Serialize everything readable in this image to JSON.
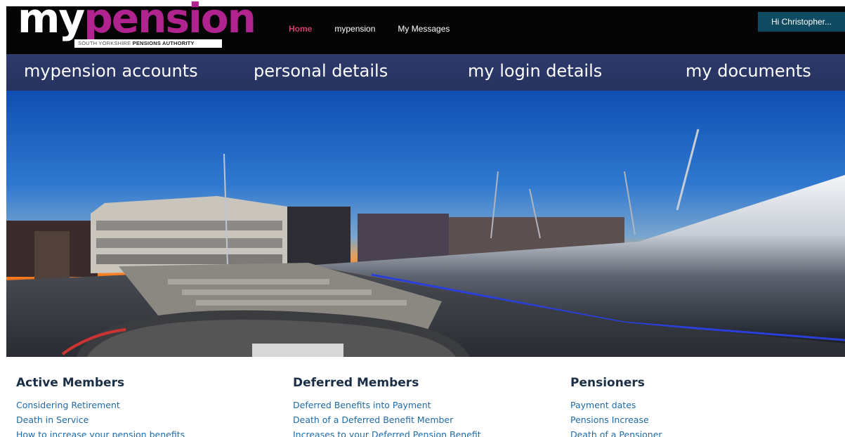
{
  "logo": {
    "my": "my",
    "pension": "pension",
    "tagline_prefix": "SOUTH YORKSHIRE",
    "tagline_bold": "PENSIONS AUTHORITY"
  },
  "topnav": {
    "home": "Home",
    "mypension": "mypension",
    "messages": "My Messages"
  },
  "greeting": "Hi Christopher...",
  "subnav": {
    "accounts": "mypension accounts",
    "personal": "personal details",
    "login": "my login details",
    "documents": "my documents"
  },
  "columns": [
    {
      "title": "Active Members",
      "links": [
        "Considering Retirement",
        "Death in Service",
        "How to increase your pension benefits"
      ]
    },
    {
      "title": "Deferred Members",
      "links": [
        "Deferred Benefits into Payment",
        "Death of a Deferred Benefit Member",
        "Increases to your Deferred Pension Benefit"
      ]
    },
    {
      "title": "Pensioners",
      "links": [
        "Payment dates",
        "Pensions Increase",
        "Death of a Pensioner"
      ]
    }
  ],
  "colors": {
    "header_bg": "#050505",
    "brand_magenta": "#b1248f",
    "nav_active": "#d33c6a",
    "greeting_bg": "#0e4a60",
    "subnav_bg": "#2d3a6b",
    "heading": "#1a2e45",
    "link": "#1e6aa8"
  }
}
